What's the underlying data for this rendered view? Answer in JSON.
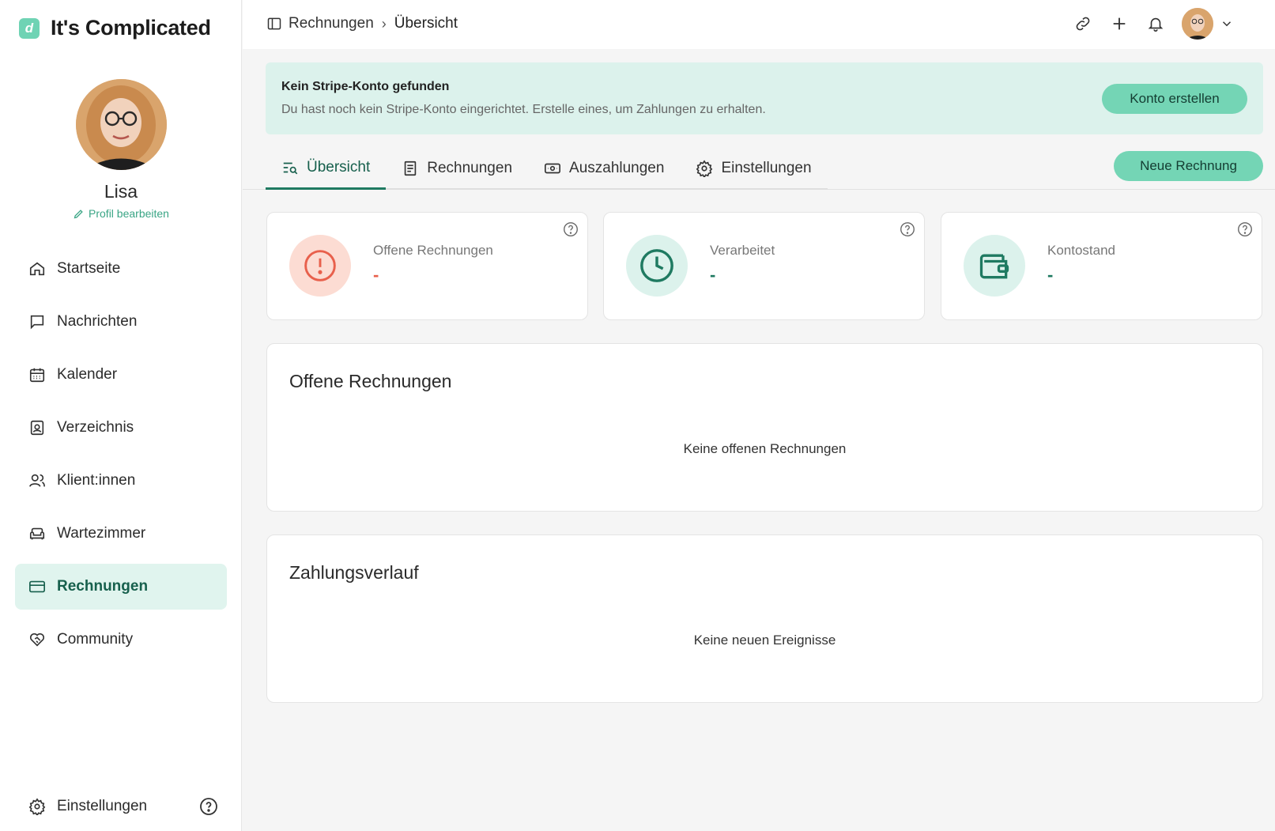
{
  "brand": {
    "mark": "d",
    "name": "It's Complicated"
  },
  "user": {
    "name": "Lisa",
    "edit_label": "Profil bearbeiten"
  },
  "sidebar": {
    "items": [
      {
        "label": "Startseite"
      },
      {
        "label": "Nachrichten"
      },
      {
        "label": "Kalender"
      },
      {
        "label": "Verzeichnis"
      },
      {
        "label": "Klient:innen"
      },
      {
        "label": "Wartezimmer"
      },
      {
        "label": "Rechnungen"
      },
      {
        "label": "Community"
      }
    ],
    "settings_label": "Einstellungen"
  },
  "breadcrumb": {
    "parent": "Rechnungen",
    "current": "Übersicht"
  },
  "alert": {
    "title": "Kein Stripe-Konto gefunden",
    "text": "Du hast noch kein Stripe-Konto eingerichtet. Erstelle eines, um Zahlungen zu erhalten.",
    "button": "Konto erstellen"
  },
  "tabs": [
    {
      "label": "Übersicht"
    },
    {
      "label": "Rechnungen"
    },
    {
      "label": "Auszahlungen"
    },
    {
      "label": "Einstellungen"
    }
  ],
  "new_invoice_button": "Neue Rechnung",
  "stats": [
    {
      "label": "Offene Rechnungen",
      "value": "-",
      "color": "#e8604c"
    },
    {
      "label": "Verarbeitet",
      "value": "-",
      "color": "#1f7a61"
    },
    {
      "label": "Kontostand",
      "value": "-",
      "color": "#1f7a61"
    }
  ],
  "open_invoices": {
    "title": "Offene Rechnungen",
    "empty": "Keine offenen Rechnungen"
  },
  "payment_history": {
    "title": "Zahlungsverlauf",
    "empty": "Keine neuen Ereignisse"
  },
  "colors": {
    "accent": "#74d5b5",
    "accent_dark": "#1f7a61",
    "alert_bg": "#dcf2ec",
    "warn": "#e8604c"
  }
}
